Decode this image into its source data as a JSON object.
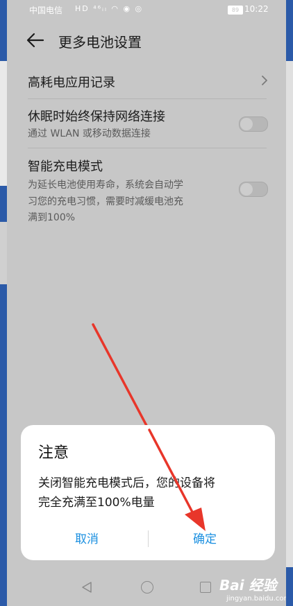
{
  "status_bar": {
    "carrier": "中国电信",
    "icons": "HD ⁴⁶ᵢₗ ◠ ◉ ◎",
    "battery": "89",
    "time": "10:22"
  },
  "header": {
    "title": "更多电池设置"
  },
  "settings": [
    {
      "label": "高耗电应用记录",
      "control": "chevron"
    },
    {
      "label": "休眠时始终保持网络连接",
      "description": "通过 WLAN 或移动数据连接",
      "control": "toggle",
      "enabled": false
    },
    {
      "label": "智能充电模式",
      "description_lines": [
        "为延长电池使用寿命，系统会自动学",
        "习您的充电习惯，需要时减缓电池充",
        "满到100%"
      ],
      "control": "toggle",
      "enabled": false
    }
  ],
  "dialog": {
    "title": "注意",
    "message_lines": [
      "关闭智能充电模式后，您的设备将",
      "完全充满至100%电量"
    ],
    "cancel_label": "取消",
    "confirm_label": "确定"
  },
  "watermark": {
    "main": "Bai 经验",
    "sub": "jingyan.baidu.com"
  },
  "colors": {
    "accent": "#1a8fe0",
    "annotation_arrow": "#e8362a",
    "overlay": "#c7c7c7"
  }
}
